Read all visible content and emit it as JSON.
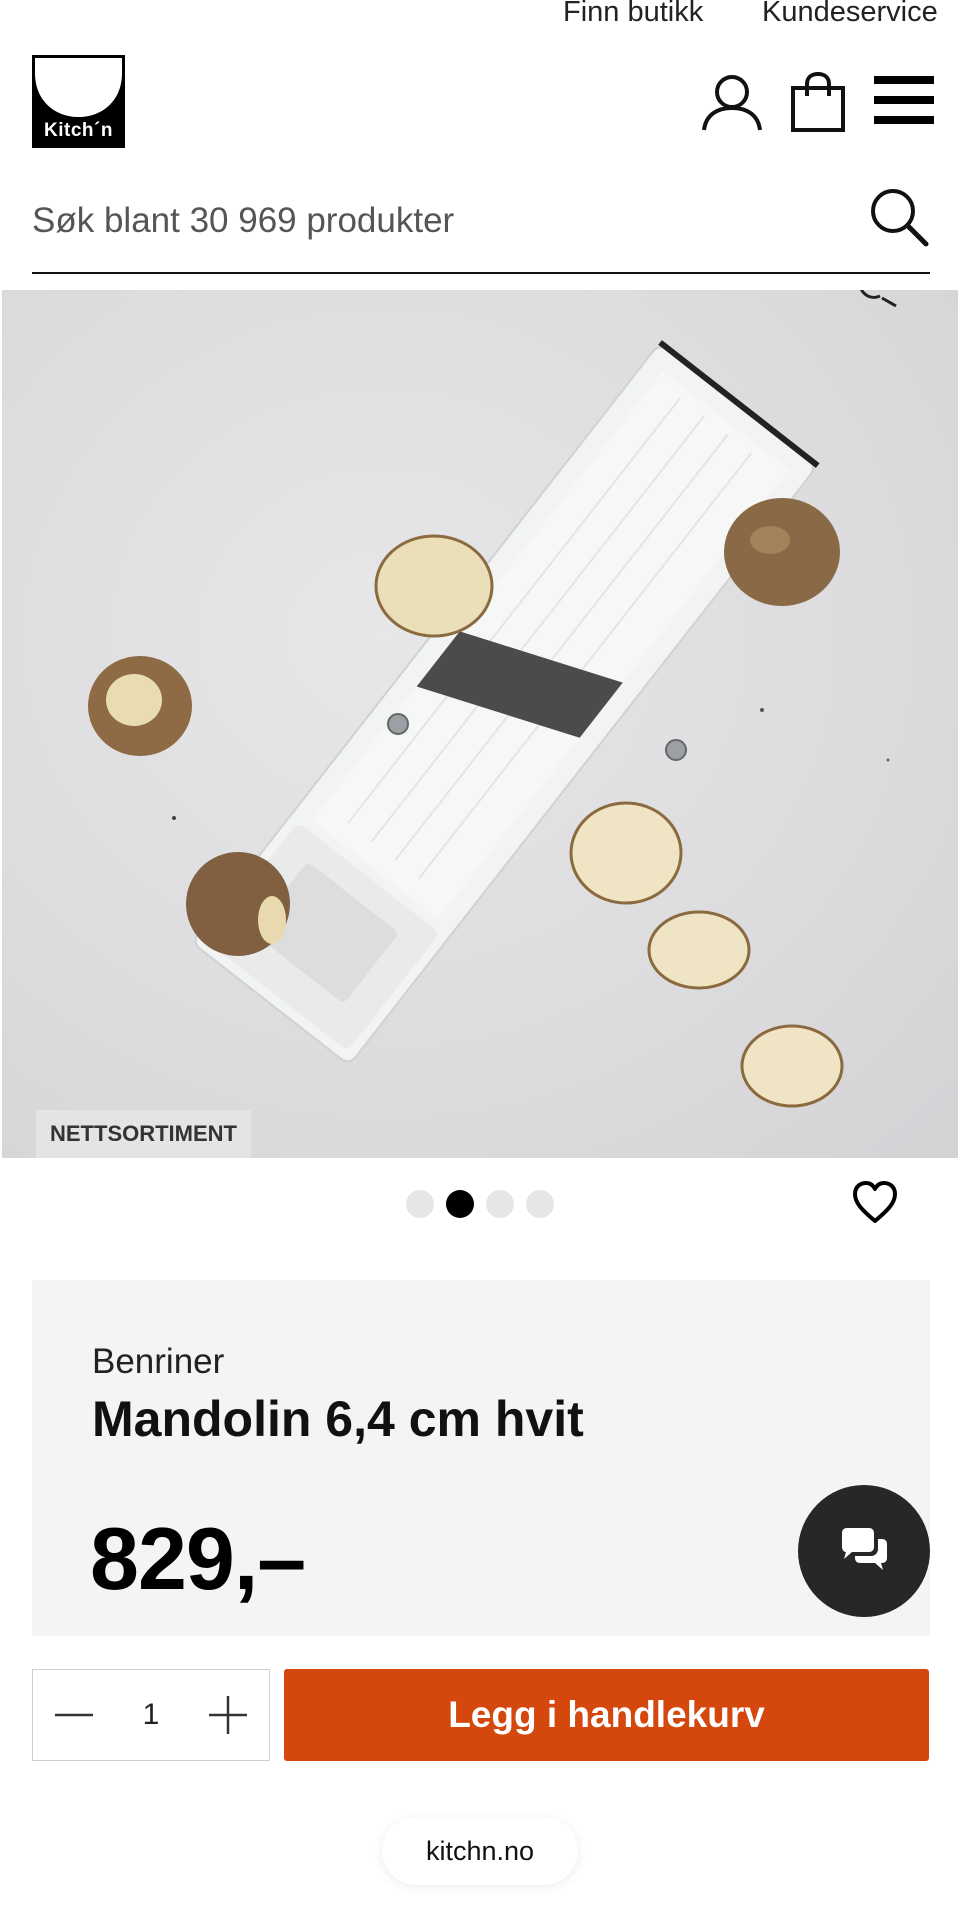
{
  "header": {
    "top_links": [
      "Finn butikk",
      "Kundeservice"
    ],
    "logo_text": "Kitch´n",
    "icons": [
      "user-icon",
      "shopping-bag-icon",
      "hamburger-menu-icon"
    ]
  },
  "search": {
    "placeholder": "Søk blant 30 969 produkter",
    "value": "",
    "icon": "search-icon"
  },
  "gallery": {
    "badge": "NETTSORTIMENT",
    "slide_count": 4,
    "active_slide": 2
  },
  "product": {
    "brand": "Benriner",
    "name": "Mandolin 6,4 cm hvit",
    "price": "829,–"
  },
  "purchase": {
    "quantity": "1",
    "add_to_cart_label": "Legg i handlekurv",
    "button_color": "#d4470d"
  },
  "footer": {
    "domain": "kitchn.no"
  }
}
